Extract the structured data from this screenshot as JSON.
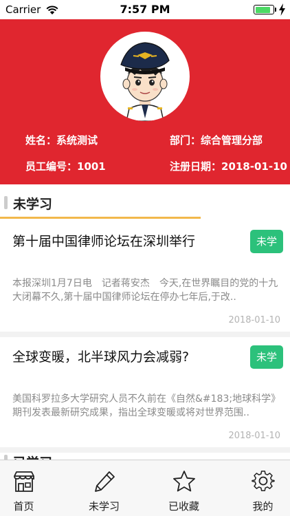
{
  "status_bar": {
    "carrier": "Carrier",
    "time": "7:57 PM",
    "battery_level": 0.9,
    "icons": [
      "wifi-icon",
      "battery-icon",
      "charging-bolt-icon"
    ]
  },
  "profile": {
    "avatar_icon": "pilot-avatar",
    "name": "姓名：系统测试",
    "department": "部门：综合管理分部",
    "employee_id": "员工编号：1001",
    "register_date": "注册日期：2018-01-10",
    "background_color": "#e0262f"
  },
  "section": {
    "title": "未学习",
    "underline_color": "#f2b84b"
  },
  "articles": [
    {
      "title": "第十届中国律师论坛在深圳举行",
      "badge": "未学",
      "summary": "本报深圳1月7日电　记者蒋安杰　今天,在世界瞩目的党的十九大闭幕不久,第十届中国律师论坛在停办七年后,于改..",
      "date": "2018-01-10"
    },
    {
      "title": "全球变暖，北半球风力会减弱?",
      "badge": "未学",
      "summary": "美国科罗拉多大学研究人员不久前在《自然&#183;地球科学》期刊发表最新研究成果，指出全球变暖或将对世界范围..",
      "date": "2018-01-10"
    }
  ],
  "next_section_title": "已学习",
  "badge_color": "#2cc17b",
  "tabs": [
    {
      "label": "首页",
      "icon": "storefront-icon"
    },
    {
      "label": "未学习",
      "icon": "pencil-icon"
    },
    {
      "label": "已收藏",
      "icon": "star-icon"
    },
    {
      "label": "我的",
      "icon": "gear-icon"
    }
  ]
}
